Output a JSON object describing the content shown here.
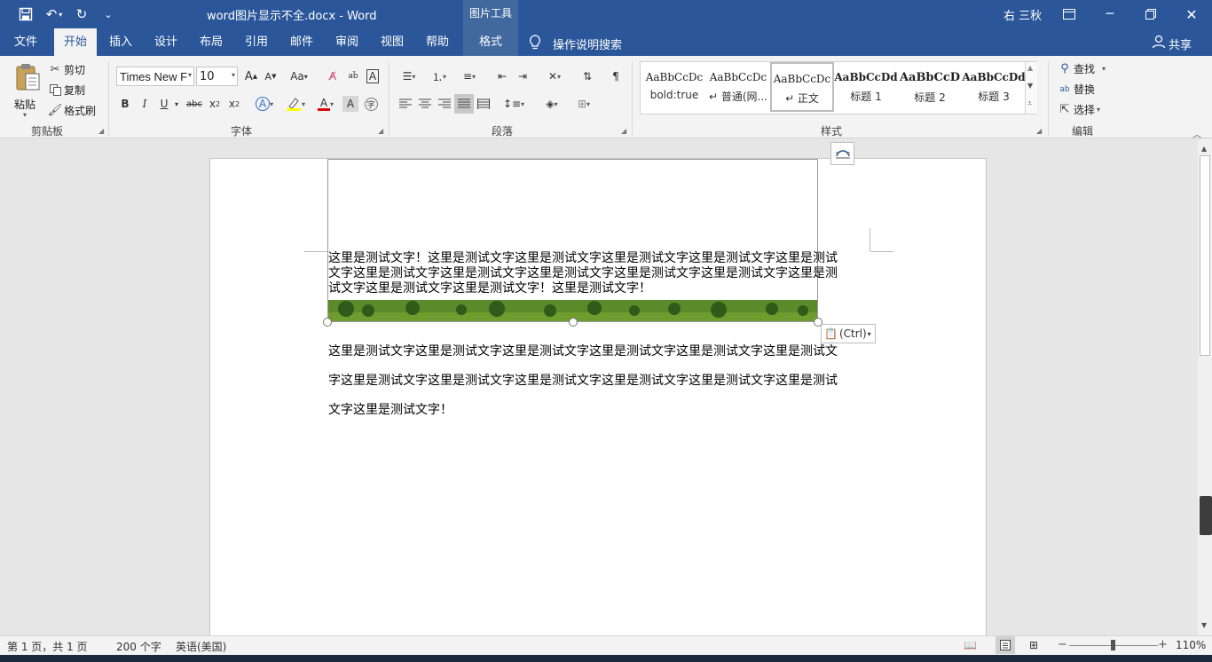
{
  "title_bar": {
    "doc_title": "word图片显示不全.docx  -  Word",
    "context_label": "图片工具",
    "user": "右 三秋"
  },
  "tabs": [
    "文件",
    "开始",
    "插入",
    "设计",
    "布局",
    "引用",
    "邮件",
    "审阅",
    "视图",
    "帮助",
    "格式"
  ],
  "tell_me": "操作说明搜索",
  "share": "共享",
  "clipboard": {
    "paste": "粘贴",
    "cut": "剪切",
    "copy": "复制",
    "format_painter": "格式刷",
    "group": "剪贴板"
  },
  "font": {
    "name": "Times New F",
    "size": "10",
    "group": "字体"
  },
  "paragraph": {
    "group": "段落"
  },
  "styles": {
    "group": "样式",
    "items": [
      {
        "sample": "AaBbCcDc",
        "name": "bold:true"
      },
      {
        "sample": "AaBbCcDc",
        "name": "↵ 普通(网..."
      },
      {
        "sample": "AaBbCcDc",
        "name": "↵ 正文"
      },
      {
        "sample": "AaBbCcDd",
        "name": "标题 1"
      },
      {
        "sample": "AaBbCcD",
        "name": "标题 2"
      },
      {
        "sample": "AaBbCcDd",
        "name": "标题 3"
      }
    ]
  },
  "editing": {
    "find": "查找",
    "replace": "替换",
    "select": "选择",
    "group": "编辑"
  },
  "document": {
    "overlap_lines": [
      "这里是测试文字！这里是测试文字这里是测试文字这里是测试文字这里是测试文字这里是测试",
      "文字这里是测试文字这里是测试文字这里是测试文字这里是测试文字这里是测试文字这里是测",
      "试文字这里是测试文字这里是测试文字！这里是测试文字！"
    ],
    "body_lines": [
      "这里是测试文字这里是测试文字这里是测试文字这里是测试文字这里是测试文字这里是测试文",
      "字这里是测试文字这里是测试文字这里是测试文字这里是测试文字这里是测试文字这里是测试",
      "文字这里是测试文字！"
    ],
    "paste_options": "(Ctrl)"
  },
  "status": {
    "page": "第 1 页，共 1 页",
    "words": "200 个字",
    "language": "英语(美国)",
    "zoom": "110%"
  },
  "colors": {
    "brand": "#2b579a",
    "highlight": "#ffff00",
    "font_color": "#e00000"
  }
}
